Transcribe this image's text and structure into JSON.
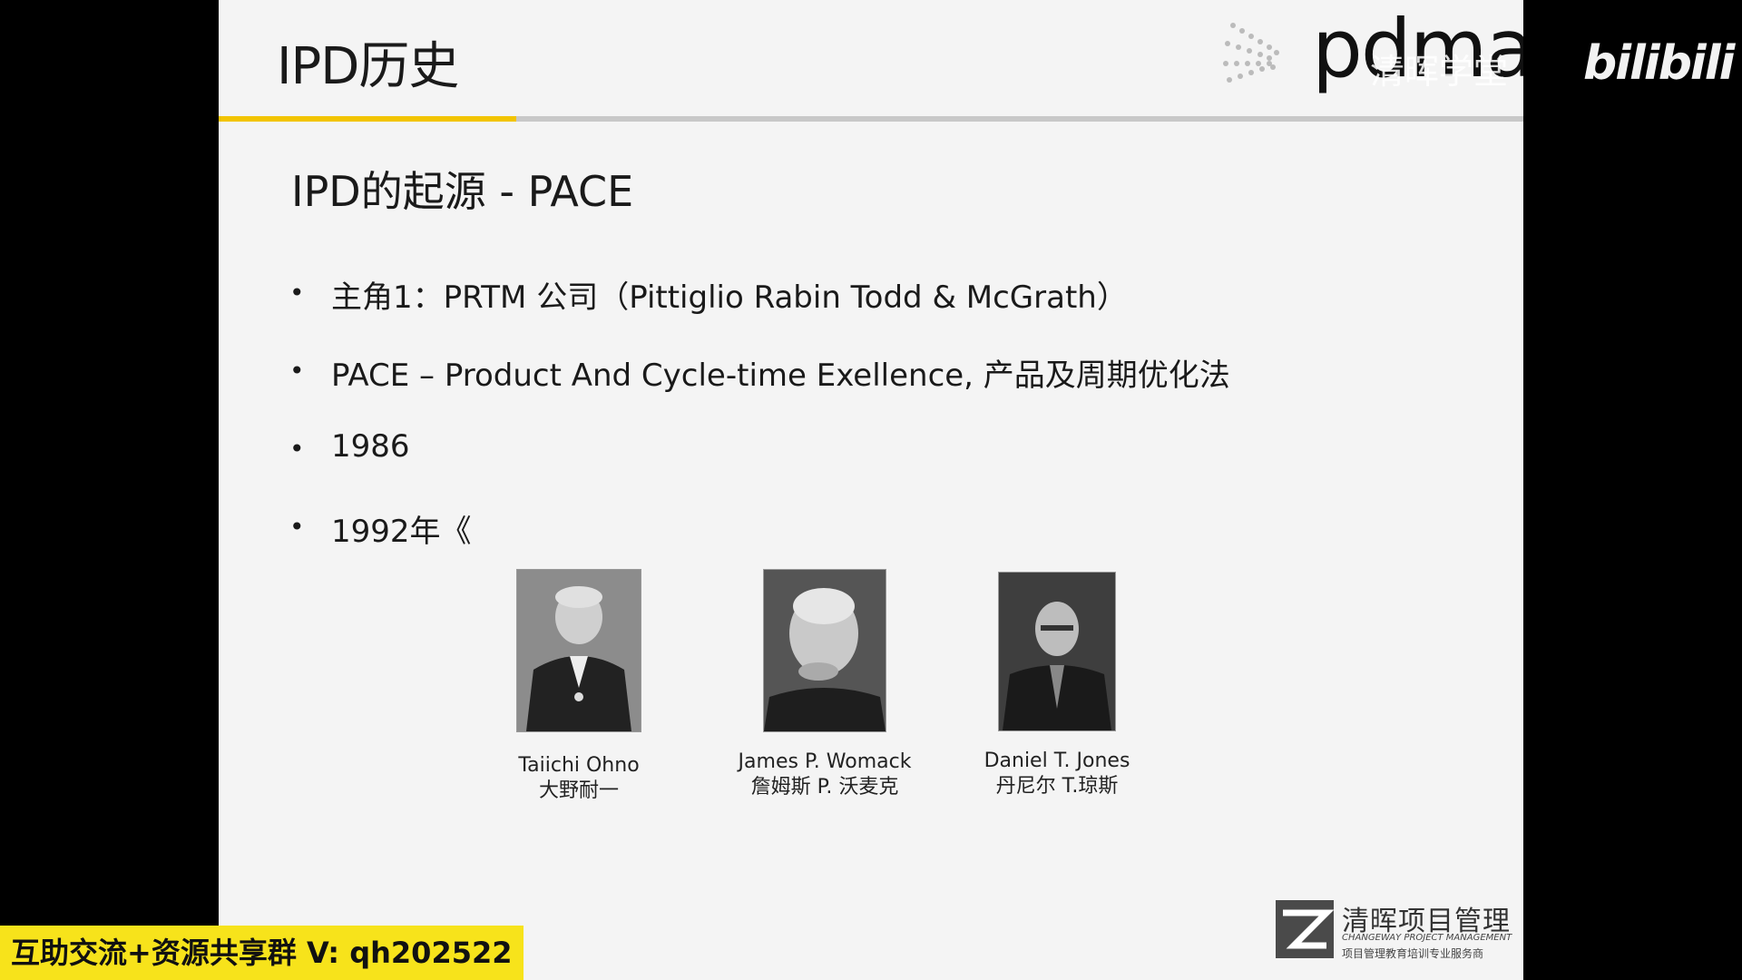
{
  "slide": {
    "title": "IPD历史",
    "subtitle": "IPD的起源 - PACE",
    "brand_logo": "pdma",
    "bullets": [
      "主角1：PRTM 公司（Pittiglio Rabin Todd & McGrath）",
      "PACE – Product And Cycle-time Exellence, 产品及周期优化法",
      "1986",
      "1992年《"
    ],
    "people": [
      {
        "name_en": "Taiichi Ohno",
        "name_cn": "大野耐一",
        "photo_icon": "portrait-icon"
      },
      {
        "name_en": "James P. Womack",
        "name_cn": "詹姆斯 P. 沃麦克",
        "photo_icon": "portrait-icon"
      },
      {
        "name_en": "Daniel T. Jones",
        "name_cn": "丹尼尔 T.琼斯",
        "photo_icon": "portrait-icon"
      }
    ],
    "company": {
      "name": "清晖项目管理",
      "name_en": "CHANGEWAY PROJECT MANAGEMENT",
      "tagline": "项目管理教育培训专业服务商"
    },
    "accent_color": "#f2c400"
  },
  "overlay": {
    "watermark_text": "清晖学堂",
    "platform_logo": "bilibili",
    "promo_text": "互助交流+资源共享群 V: qh202522"
  }
}
